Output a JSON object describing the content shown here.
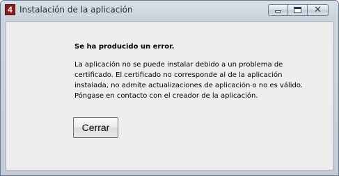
{
  "window": {
    "title": "Instalación de la aplicación",
    "app_icon_glyph": "4",
    "app_icon_color": "#8b1a1a",
    "caption_buttons": {
      "minimize": "minimize-icon",
      "maximize": "maximize-icon",
      "close": "close-icon",
      "close_glyph": "✕"
    }
  },
  "dialog": {
    "heading": "Se ha producido un error.",
    "message": "La aplicación no se puede instalar debido a un problema de certificado. El certificado no corresponde al de la aplicación instalada, no admite actualizaciones de aplicación o no es válido. Póngase en contacto con el creador de la aplicación.",
    "close_button_label": "Cerrar"
  }
}
